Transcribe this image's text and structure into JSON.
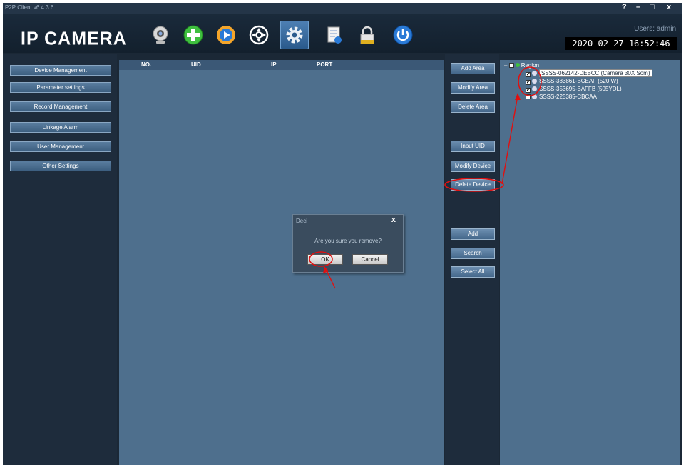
{
  "window": {
    "title": "P2P Client v6.4.3.6",
    "controls": [
      "?",
      "–",
      "□",
      "x"
    ]
  },
  "header": {
    "logo": "IP CAMERA",
    "users_label": "Users: admin",
    "clock": "2020-02-27  16:52:46",
    "toolbar_icons": [
      "camera-icon",
      "add-icon",
      "playback-icon",
      "ptz-icon",
      "settings-icon",
      "log-icon",
      "lock-icon",
      "power-icon"
    ]
  },
  "sidebar": {
    "items": [
      {
        "label": "Device Management"
      },
      {
        "label": "Parameter settings"
      },
      {
        "label": "Record Management"
      },
      {
        "label": "Linkage Alarm"
      },
      {
        "label": "User Management"
      },
      {
        "label": "Other Settings"
      }
    ]
  },
  "table": {
    "columns": [
      "NO.",
      "UID",
      "IP",
      "PORT"
    ]
  },
  "actions": {
    "add_area": "Add Area",
    "modify_area": "Modify Area",
    "delete_area": "Delete Area",
    "input_uid": "Input UID",
    "modify_device": "Modify Device",
    "delete_device": "Delete Device",
    "add": "Add",
    "search": "Search",
    "select_all": "Select All"
  },
  "tree": {
    "root": "Region",
    "devices": [
      {
        "label": "SSSS-062142-DEBCC  (Camera 30X Som)",
        "checked": true,
        "selected": true
      },
      {
        "label": "SSSS-383861-BCEAF  (520 W)",
        "checked": true,
        "selected": false
      },
      {
        "label": "SSSS-353695-BAFFB  (505YDL)",
        "checked": true,
        "selected": false
      },
      {
        "label": "SSSS-225385-CBCAA",
        "checked": false,
        "selected": false
      }
    ]
  },
  "dialog": {
    "title": "Deci",
    "close": "x",
    "message": "Are you sure you remove?",
    "ok": "OK",
    "cancel": "Cancel"
  },
  "colors": {
    "annotation": "#e01010",
    "panel": "#4e6f8d",
    "background": "#1b2836"
  }
}
